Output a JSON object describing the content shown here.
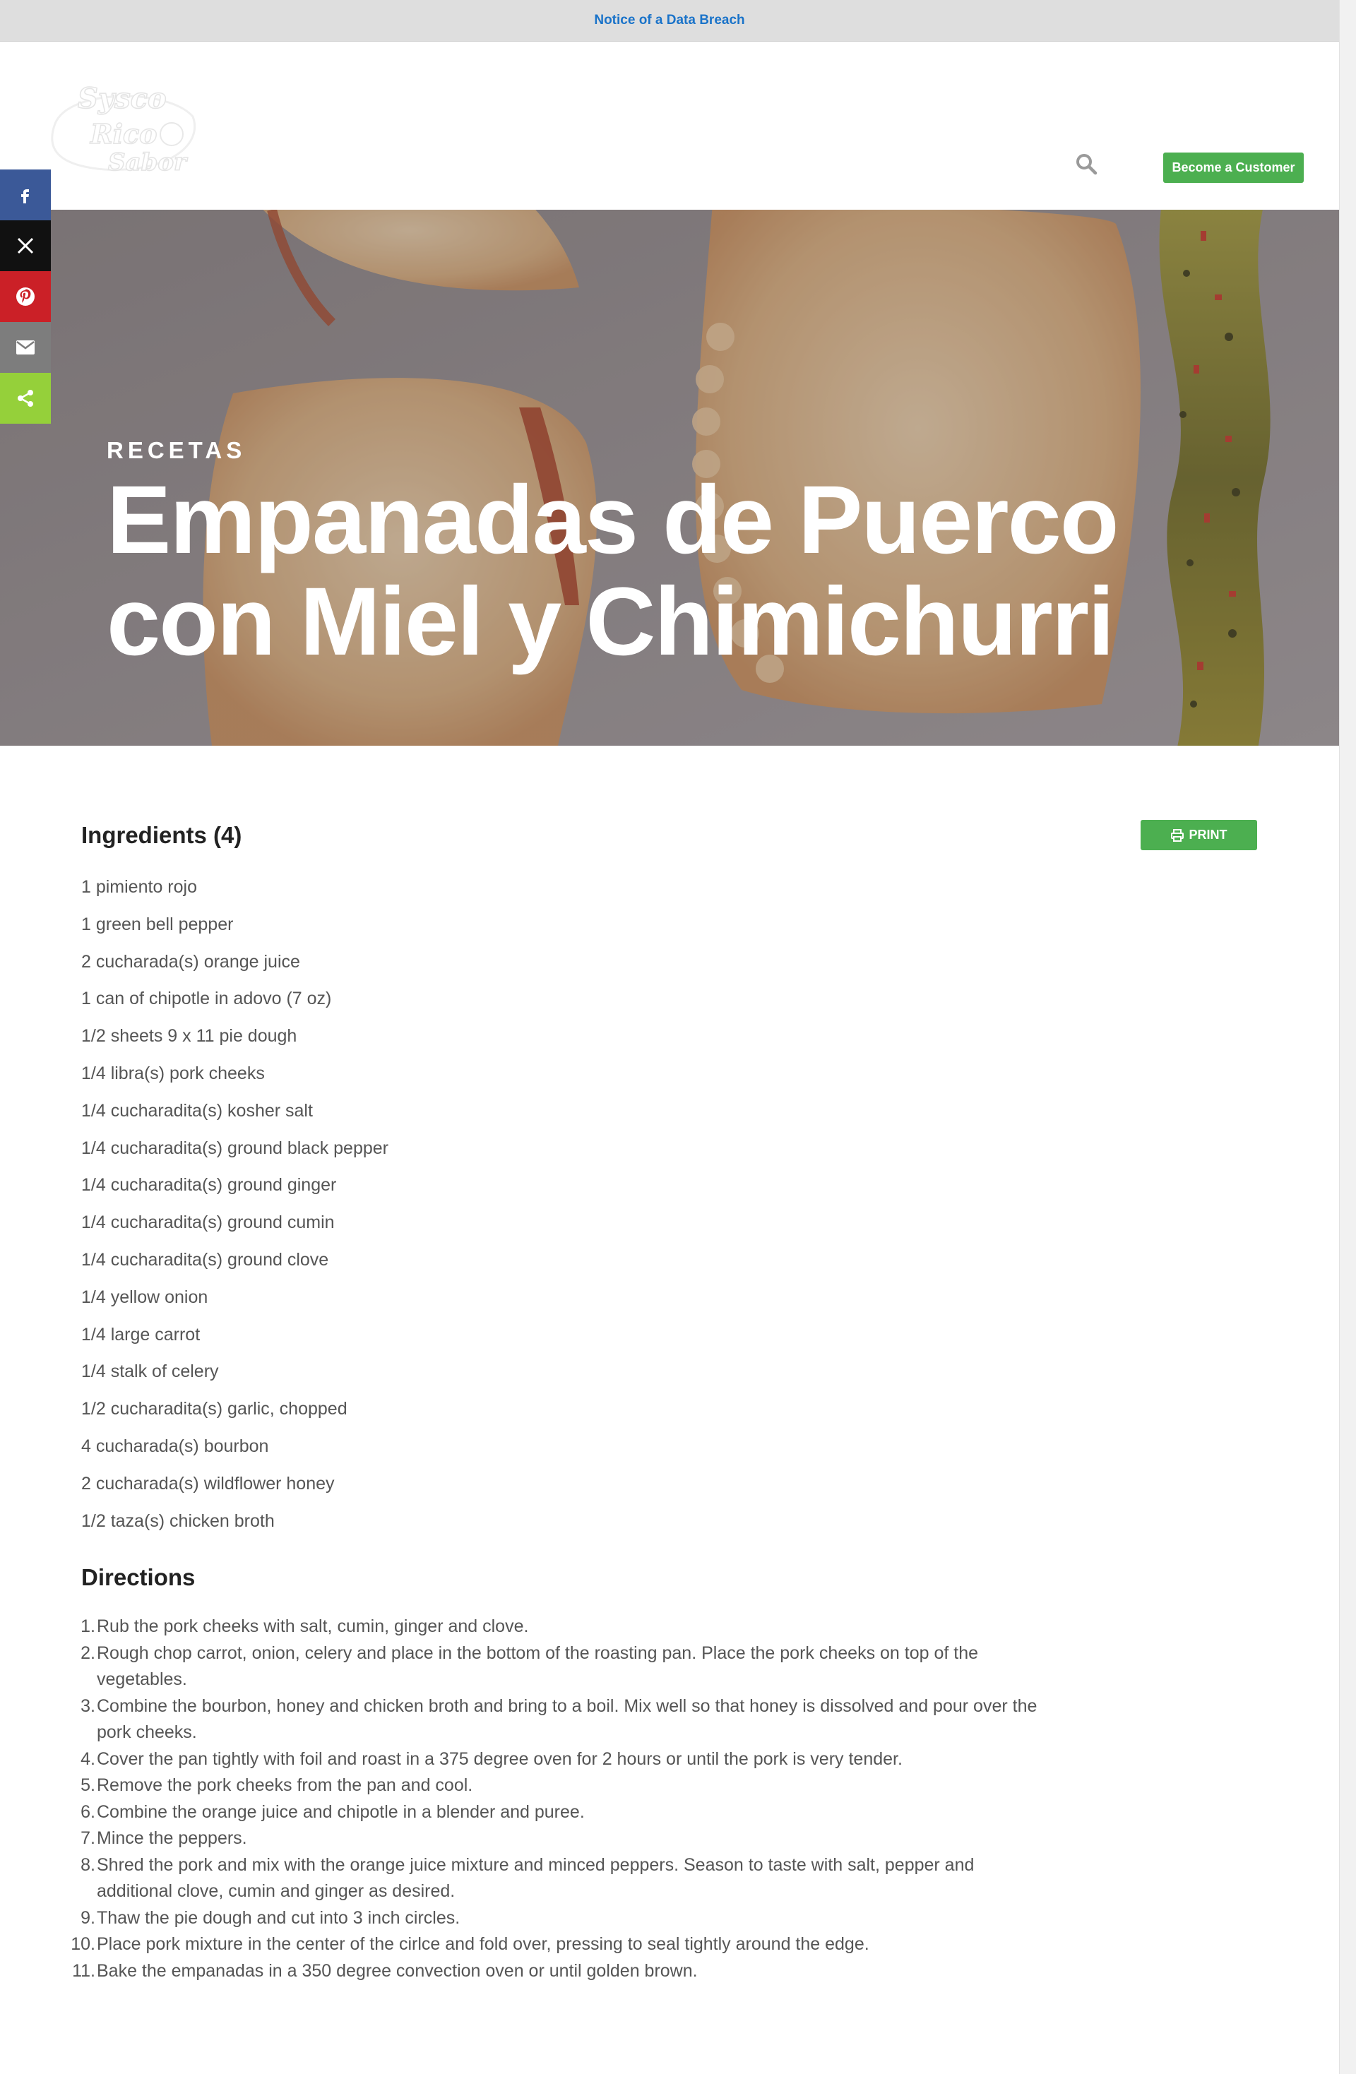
{
  "notice": {
    "link": "Notice of a Data Breach"
  },
  "header": {
    "logo_text_line1": "Sysco",
    "logo_text_line2": "Rico",
    "logo_text_line3": "Sabor",
    "search_icon": "search-icon",
    "cta_label": "Become a Customer"
  },
  "share": {
    "items": [
      {
        "network": "facebook",
        "icon": "facebook-icon",
        "color": "#3b5998"
      },
      {
        "network": "x",
        "icon": "x-icon",
        "color": "#111111"
      },
      {
        "network": "pinterest",
        "icon": "pinterest-icon",
        "color": "#cb2027"
      },
      {
        "network": "email",
        "icon": "email-icon",
        "color": "#7d7d7d"
      },
      {
        "network": "more",
        "icon": "share-icon",
        "color": "#95d03a"
      }
    ]
  },
  "hero": {
    "kicker": "RECETAS",
    "title_line1": "Empanadas de Puerco",
    "title_line2": "con Miel y Chimichurri"
  },
  "recipe": {
    "ingredients_title": "Ingredients (4)",
    "print_label": "PRINT",
    "print_icon": "printer-icon",
    "ingredients": [
      "1 pimiento rojo",
      "1 green bell pepper",
      "2 cucharada(s) orange juice",
      "1 can of chipotle in adovo (7 oz)",
      "1/2 sheets 9 x 11 pie dough",
      "1/4 libra(s) pork cheeks",
      "1/4 cucharadita(s) kosher salt",
      "1/4 cucharadita(s) ground black pepper",
      "1/4 cucharadita(s) ground ginger",
      "1/4 cucharadita(s) ground cumin",
      "1/4 cucharadita(s) ground clove",
      "1/4 yellow onion",
      "1/4 large carrot",
      "1/4 stalk of celery",
      "1/2 cucharadita(s) garlic, chopped",
      "4 cucharada(s) bourbon",
      "2 cucharada(s) wildflower honey",
      "1/2 taza(s) chicken broth"
    ],
    "directions_title": "Directions",
    "directions": [
      "Rub the pork cheeks with salt, cumin, ginger and clove.",
      "Rough chop carrot, onion, celery and place in the bottom of the roasting pan. Place the pork cheeks on top of the vegetables.",
      "Combine the bourbon, honey and chicken broth and bring to a boil. Mix well so that honey is dissolved and pour over the pork cheeks.",
      "Cover the pan tightly with foil and roast in a 375 degree oven for 2 hours or until the pork is very tender.",
      "Remove the pork cheeks from the pan and cool.",
      "Combine the orange juice and chipotle in a blender and puree.",
      "Mince the peppers.",
      "Shred the pork and mix with the orange juice mixture and minced peppers. Season to taste with salt, pepper and additional clove, cumin and ginger as desired.",
      "Thaw the pie dough and cut into 3 inch circles.",
      "Place pork mixture in the center of the cirlce and fold over, pressing to seal tightly around the edge.",
      "Bake the empanadas in a 350 degree convection oven or until golden brown."
    ]
  }
}
